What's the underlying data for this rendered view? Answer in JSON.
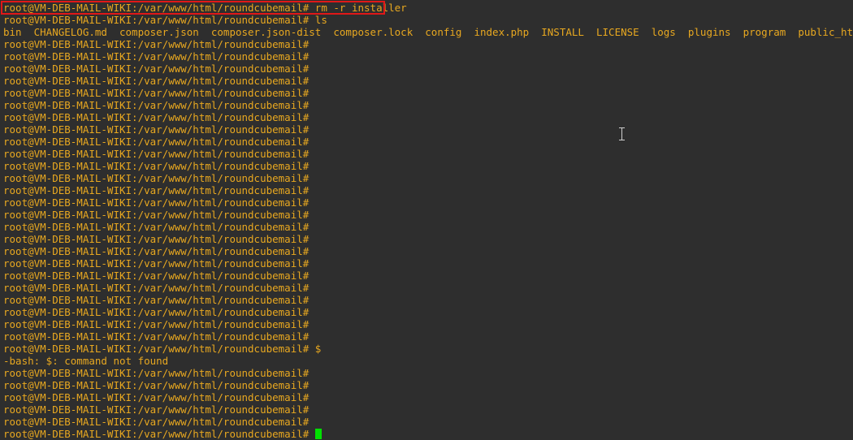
{
  "terminal": {
    "prompt": "root@VM-DEB-MAIL-WIKI:/var/www/html/roundcubemail#",
    "lines": [
      "root@VM-DEB-MAIL-WIKI:/var/www/html/roundcubemail# rm -r installer",
      "root@VM-DEB-MAIL-WIKI:/var/www/html/roundcubemail# ls",
      "bin  CHANGELOG.md  composer.json  composer.json-dist  composer.lock  config  index.php  INSTALL  LICENSE  logs  plugins  program  public_html  README.",
      "root@VM-DEB-MAIL-WIKI:/var/www/html/roundcubemail#",
      "root@VM-DEB-MAIL-WIKI:/var/www/html/roundcubemail#",
      "root@VM-DEB-MAIL-WIKI:/var/www/html/roundcubemail#",
      "root@VM-DEB-MAIL-WIKI:/var/www/html/roundcubemail#",
      "root@VM-DEB-MAIL-WIKI:/var/www/html/roundcubemail#",
      "root@VM-DEB-MAIL-WIKI:/var/www/html/roundcubemail#",
      "root@VM-DEB-MAIL-WIKI:/var/www/html/roundcubemail#",
      "root@VM-DEB-MAIL-WIKI:/var/www/html/roundcubemail#",
      "root@VM-DEB-MAIL-WIKI:/var/www/html/roundcubemail#",
      "root@VM-DEB-MAIL-WIKI:/var/www/html/roundcubemail#",
      "root@VM-DEB-MAIL-WIKI:/var/www/html/roundcubemail#",
      "root@VM-DEB-MAIL-WIKI:/var/www/html/roundcubemail#",
      "root@VM-DEB-MAIL-WIKI:/var/www/html/roundcubemail#",
      "root@VM-DEB-MAIL-WIKI:/var/www/html/roundcubemail#",
      "root@VM-DEB-MAIL-WIKI:/var/www/html/roundcubemail#",
      "root@VM-DEB-MAIL-WIKI:/var/www/html/roundcubemail#",
      "root@VM-DEB-MAIL-WIKI:/var/www/html/roundcubemail#",
      "root@VM-DEB-MAIL-WIKI:/var/www/html/roundcubemail#",
      "root@VM-DEB-MAIL-WIKI:/var/www/html/roundcubemail#",
      "root@VM-DEB-MAIL-WIKI:/var/www/html/roundcubemail#",
      "root@VM-DEB-MAIL-WIKI:/var/www/html/roundcubemail#",
      "root@VM-DEB-MAIL-WIKI:/var/www/html/roundcubemail#",
      "root@VM-DEB-MAIL-WIKI:/var/www/html/roundcubemail#",
      "root@VM-DEB-MAIL-WIKI:/var/www/html/roundcubemail#",
      "root@VM-DEB-MAIL-WIKI:/var/www/html/roundcubemail#",
      "root@VM-DEB-MAIL-WIKI:/var/www/html/roundcubemail# $",
      "-bash: $: command not found",
      "root@VM-DEB-MAIL-WIKI:/var/www/html/roundcubemail#",
      "root@VM-DEB-MAIL-WIKI:/var/www/html/roundcubemail#",
      "root@VM-DEB-MAIL-WIKI:/var/www/html/roundcubemail#",
      "root@VM-DEB-MAIL-WIKI:/var/www/html/roundcubemail#",
      "root@VM-DEB-MAIL-WIKI:/var/www/html/roundcubemail#"
    ],
    "current_prompt": "root@VM-DEB-MAIL-WIKI:/var/www/html/roundcubemail# ",
    "text_color": "#e8a820",
    "background_color": "#2e2e2e",
    "cursor_color": "#00e000",
    "highlight_color": "#e01818",
    "mouse_pointer": "ibeam-icon"
  }
}
